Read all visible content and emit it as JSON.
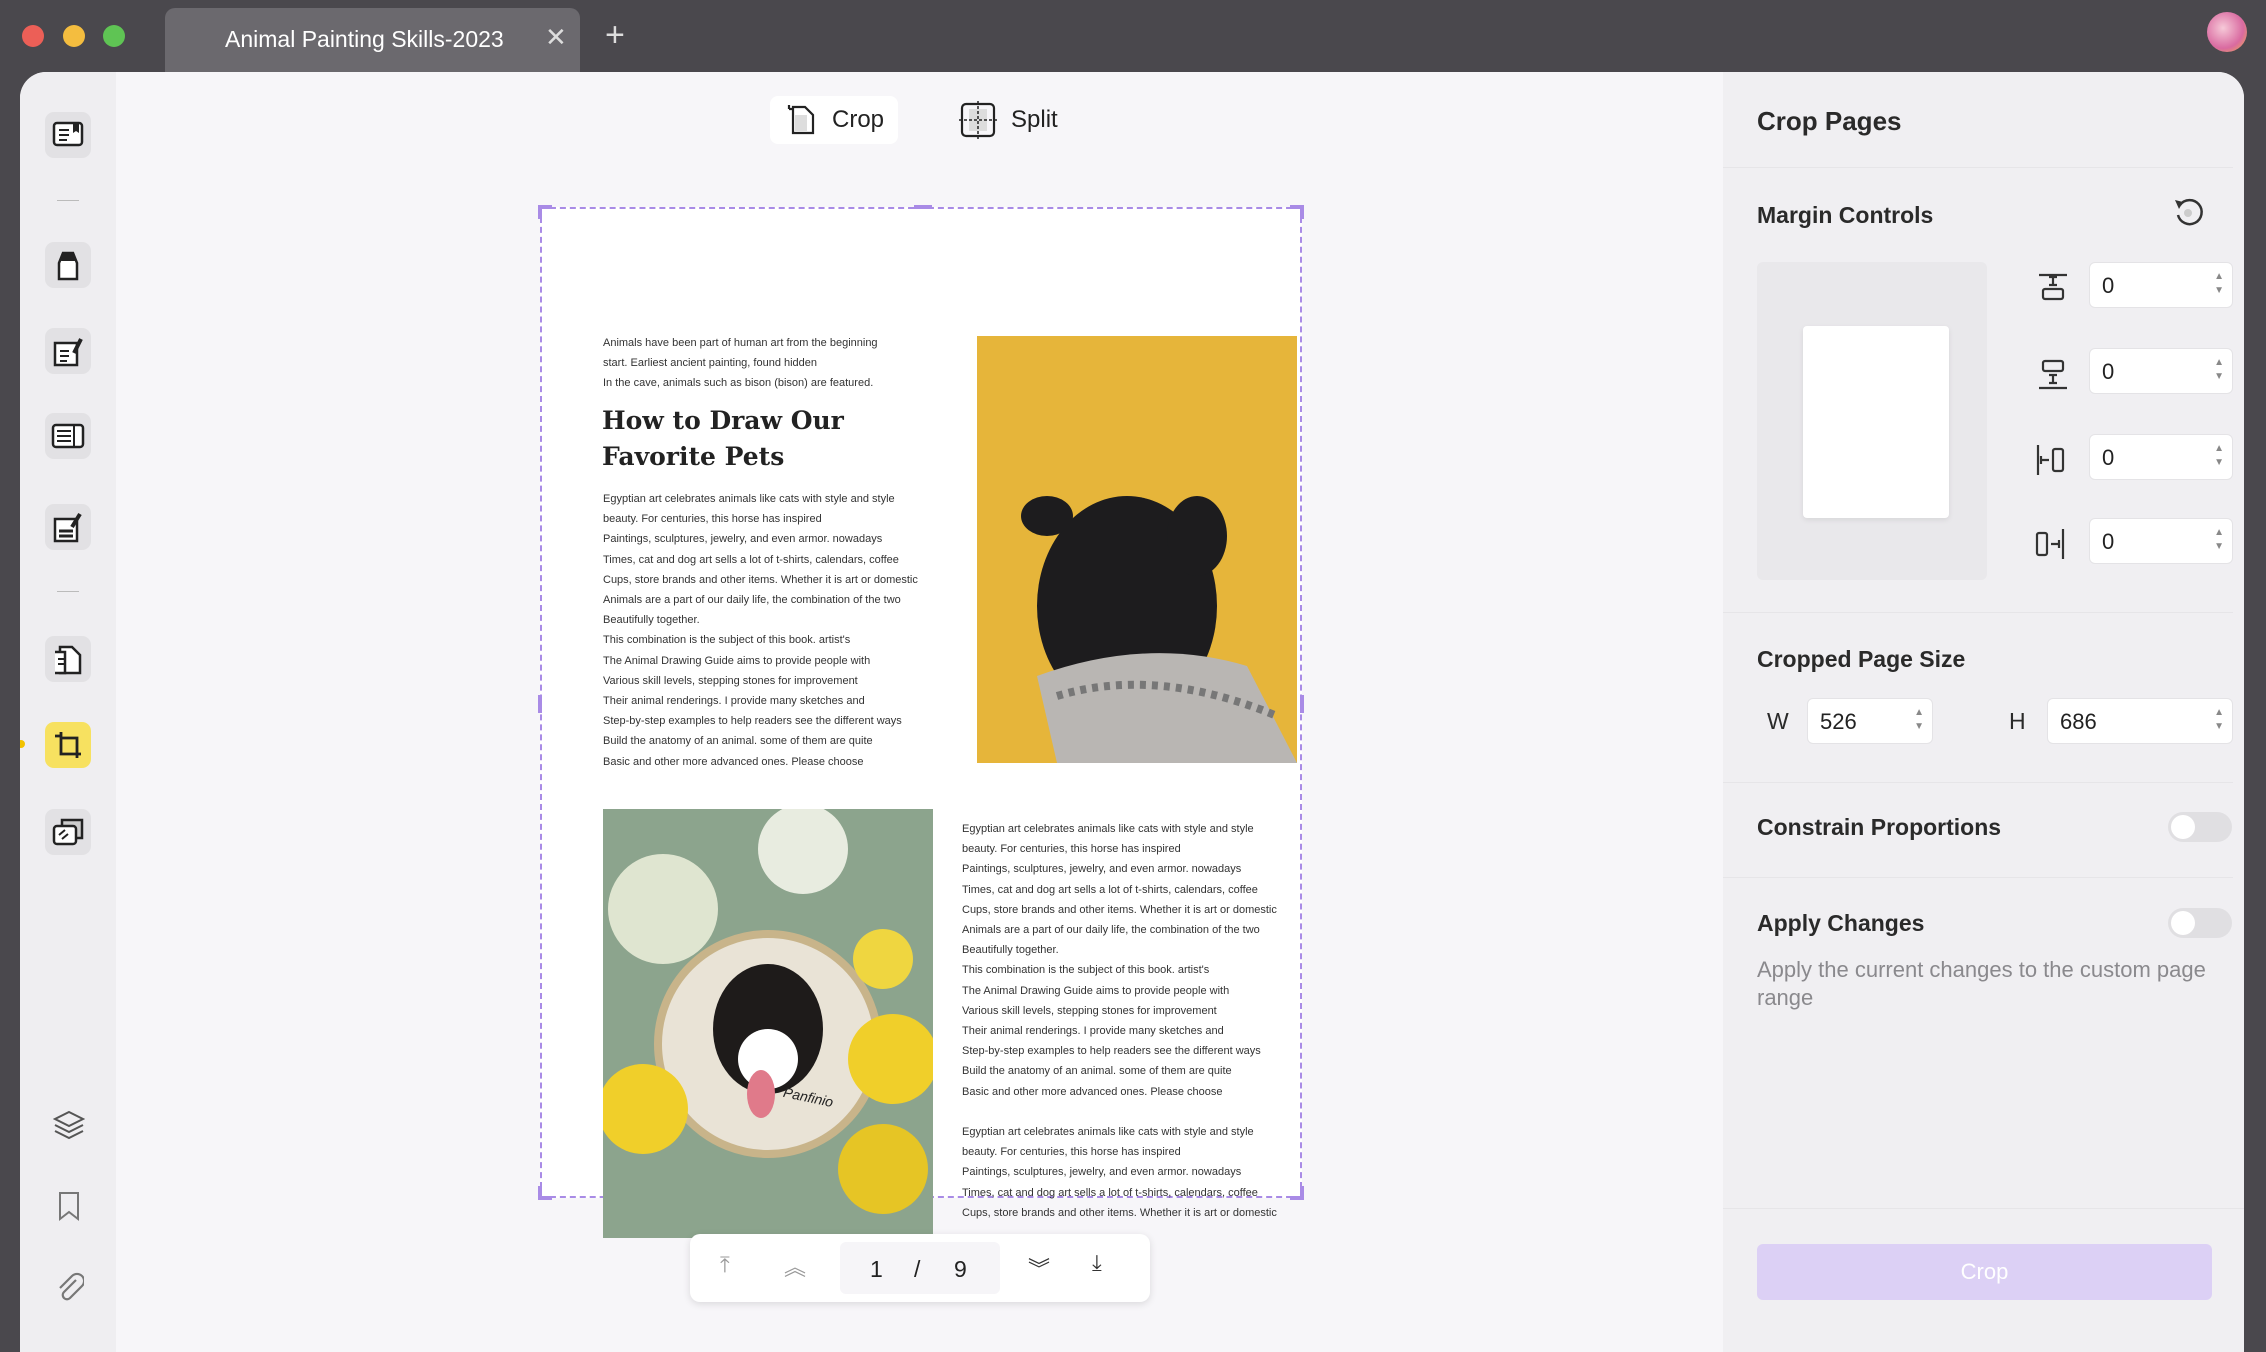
{
  "titlebar": {
    "tab_title": "Animal Painting Skills-2023",
    "close_icon": "close-icon",
    "new_tab_icon": "plus-icon"
  },
  "sidebar": {
    "items": [
      "reader",
      "comment",
      "edit-text",
      "form",
      "sign",
      "organize-pages",
      "crop-pages",
      "compress"
    ],
    "active": "crop-pages",
    "bottom": [
      "layers",
      "bookmark",
      "attachment"
    ],
    "active_color": "#f7e160"
  },
  "toolbar": {
    "crop_label": "Crop",
    "split_label": "Split"
  },
  "document": {
    "intro": "Animals have been part of human art from the beginning\nstart. Earliest ancient painting, found hidden\nIn the cave, animals such as bison (bison) are featured.",
    "heading": "How to Draw Our\nFavorite Pets",
    "body": "Egyptian art celebrates animals like cats with style and style\nbeauty. For centuries, this horse has inspired\nPaintings, sculptures, jewelry, and even armor. nowadays\nTimes, cat and dog art sells a lot of t-shirts, calendars, coffee\nCups, store brands and other items. Whether it is art or domestic\nAnimals are a part of our daily life, the combination of the two\nBeautifully together.\nThis combination is the subject of this book. artist's\nThe Animal Drawing Guide aims to provide people with\nVarious skill levels, stepping stones for improvement\nTheir animal renderings. I provide many sketches and\nStep-by-step examples to help readers see the different ways\nBuild the anatomy of an animal. some of them are quite\nBasic and other more advanced ones. Please choose",
    "body2": "Egyptian art celebrates animals like cats with style and style\nbeauty. For centuries, this horse has inspired\nPaintings, sculptures, jewelry, and even armor. nowadays\nTimes, cat and dog art sells a lot of t-shirts, calendars, coffee\nCups, store brands and other items. Whether it is art or domestic",
    "signature": "Panfinio"
  },
  "pagination": {
    "current": "1",
    "separator": "/",
    "total": "9"
  },
  "panel": {
    "title": "Crop Pages",
    "margin_title": "Margin Controls",
    "margins": {
      "top": "0",
      "bottom": "0",
      "left": "0",
      "right": "0"
    },
    "size_title": "Cropped Page Size",
    "w_label": "W",
    "w": "526",
    "h_label": "H",
    "h": "686",
    "constrain_label": "Constrain Proportions",
    "constrain_on": false,
    "apply_label": "Apply Changes",
    "apply_on": false,
    "apply_desc": "Apply the current changes to the custom page range",
    "crop_button": "Crop",
    "accent": "#a98be6"
  }
}
